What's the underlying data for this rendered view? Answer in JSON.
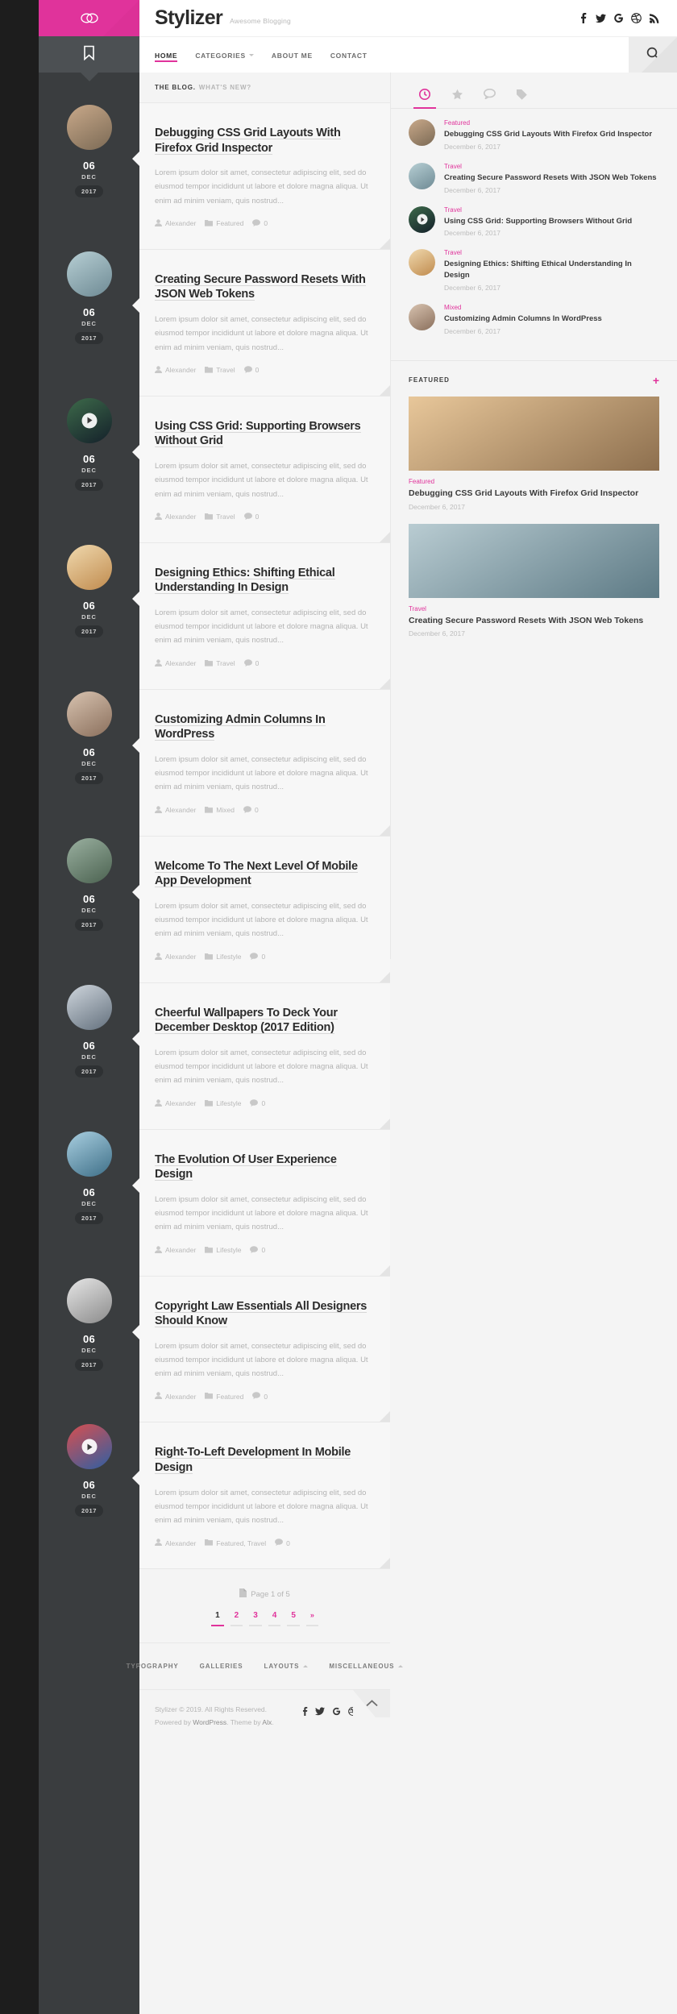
{
  "site": {
    "title": "Stylizer",
    "tagline": "Awesome Blogging",
    "logo_icon": "infinity-logo-icon",
    "bookmark_icon": "bookmark-icon"
  },
  "social": [
    {
      "name": "facebook-icon",
      "label": "f"
    },
    {
      "name": "twitter-icon",
      "label": "t"
    },
    {
      "name": "google-icon",
      "label": "G"
    },
    {
      "name": "dribbble-icon",
      "label": "d"
    },
    {
      "name": "rss-icon",
      "label": "r"
    }
  ],
  "nav": [
    {
      "label": "HOME",
      "active": true,
      "caret": false
    },
    {
      "label": "CATEGORIES",
      "active": false,
      "caret": true
    },
    {
      "label": "ABOUT ME",
      "active": false,
      "caret": false
    },
    {
      "label": "CONTACT",
      "active": false,
      "caret": false
    }
  ],
  "search": {
    "icon": "search-icon",
    "label": "Search"
  },
  "blogbar": {
    "primary": "THE BLOG.",
    "secondary": "WHAT'S NEW?"
  },
  "posts": [
    {
      "title": "Debugging CSS Grid Layouts With Firefox Grid Inspector",
      "excerpt": "Lorem ipsum dolor sit amet, consectetur adipiscing elit, sed do eiusmod tempor incididunt ut labore et dolore magna aliqua. Ut enim ad minim veniam, quis nostrud...",
      "author": "Alexander",
      "category": "Featured",
      "comments": "0",
      "day": "06",
      "month": "DEC",
      "year": "2017",
      "has_video": false,
      "thumb_colors": [
        "#c9a98a",
        "#7b6a55"
      ]
    },
    {
      "title": "Creating Secure Password Resets With JSON Web Tokens",
      "excerpt": "Lorem ipsum dolor sit amet, consectetur adipiscing elit, sed do eiusmod tempor incididunt ut labore et dolore magna aliqua. Ut enim ad minim veniam, quis nostrud...",
      "author": "Alexander",
      "category": "Travel",
      "comments": "0",
      "day": "06",
      "month": "DEC",
      "year": "2017",
      "has_video": false,
      "thumb_colors": [
        "#b7cfd4",
        "#6e8a94"
      ]
    },
    {
      "title": "Using CSS Grid: Supporting Browsers Without Grid",
      "excerpt": "Lorem ipsum dolor sit amet, consectetur adipiscing elit, sed do eiusmod tempor incididunt ut labore et dolore magna aliqua. Ut enim ad minim veniam, quis nostrud...",
      "author": "Alexander",
      "category": "Travel",
      "comments": "0",
      "day": "06",
      "month": "DEC",
      "year": "2017",
      "has_video": true,
      "thumb_colors": [
        "#3d6a4a",
        "#14202a"
      ]
    },
    {
      "title": "Designing Ethics: Shifting Ethical Understanding In Design",
      "excerpt": "Lorem ipsum dolor sit amet, consectetur adipiscing elit, sed do eiusmod tempor incididunt ut labore et dolore magna aliqua. Ut enim ad minim veniam, quis nostrud...",
      "author": "Alexander",
      "category": "Travel",
      "comments": "0",
      "day": "06",
      "month": "DEC",
      "year": "2017",
      "has_video": false,
      "thumb_colors": [
        "#f0d9ae",
        "#c08b4e"
      ]
    },
    {
      "title": "Customizing Admin Columns In WordPress",
      "excerpt": "Lorem ipsum dolor sit amet, consectetur adipiscing elit, sed do eiusmod tempor incididunt ut labore et dolore magna aliqua. Ut enim ad minim veniam, quis nostrud...",
      "author": "Alexander",
      "category": "Mixed",
      "comments": "0",
      "day": "06",
      "month": "DEC",
      "year": "2017",
      "has_video": false,
      "thumb_colors": [
        "#d8c3b0",
        "#8a6f5c"
      ]
    },
    {
      "title": "Welcome To The Next Level Of Mobile App Development",
      "excerpt": "Lorem ipsum dolor sit amet, consectetur adipiscing elit, sed do eiusmod tempor incididunt ut labore et dolore magna aliqua. Ut enim ad minim veniam, quis nostrud...",
      "author": "Alexander",
      "category": "Lifestyle",
      "comments": "0",
      "day": "06",
      "month": "DEC",
      "year": "2017",
      "has_video": false,
      "thumb_colors": [
        "#9ab0a0",
        "#4b6250"
      ]
    },
    {
      "title": "Cheerful Wallpapers To Deck Your December Desktop (2017 Edition)",
      "excerpt": "Lorem ipsum dolor sit amet, consectetur adipiscing elit, sed do eiusmod tempor incididunt ut labore et dolore magna aliqua. Ut enim ad minim veniam, quis nostrud...",
      "author": "Alexander",
      "category": "Lifestyle",
      "comments": "0",
      "day": "06",
      "month": "DEC",
      "year": "2017",
      "has_video": false,
      "thumb_colors": [
        "#cfd6dd",
        "#63707d"
      ]
    },
    {
      "title": "The Evolution Of User Experience Design",
      "excerpt": "Lorem ipsum dolor sit amet, consectetur adipiscing elit, sed do eiusmod tempor incididunt ut labore et dolore magna aliqua. Ut enim ad minim veniam, quis nostrud...",
      "author": "Alexander",
      "category": "Lifestyle",
      "comments": "0",
      "day": "06",
      "month": "DEC",
      "year": "2017",
      "has_video": false,
      "thumb_colors": [
        "#a9cfe0",
        "#3e6f88"
      ]
    },
    {
      "title": "Copyright Law Essentials All Designers Should Know",
      "excerpt": "Lorem ipsum dolor sit amet, consectetur adipiscing elit, sed do eiusmod tempor incididunt ut labore et dolore magna aliqua. Ut enim ad minim veniam, quis nostrud...",
      "author": "Alexander",
      "category": "Featured",
      "comments": "0",
      "day": "06",
      "month": "DEC",
      "year": "2017",
      "has_video": false,
      "thumb_colors": [
        "#e6e6e6",
        "#8b8b8b"
      ]
    },
    {
      "title": "Right-To-Left Development In Mobile Design",
      "excerpt": "Lorem ipsum dolor sit amet, consectetur adipiscing elit, sed do eiusmod tempor incididunt ut labore et dolore magna aliqua. Ut enim ad minim veniam, quis nostrud...",
      "author": "Alexander",
      "category": "Featured, Travel",
      "comments": "0",
      "day": "06",
      "month": "DEC",
      "year": "2017",
      "has_video": true,
      "thumb_colors": [
        "#d94f4f",
        "#2e5fa3"
      ]
    }
  ],
  "sidebar": {
    "tabs": [
      {
        "name": "recent-clock-icon",
        "active": true
      },
      {
        "name": "popular-star-icon",
        "active": false
      },
      {
        "name": "comments-icon",
        "active": false
      },
      {
        "name": "tags-icon",
        "active": false
      }
    ],
    "recent": [
      {
        "category": "Featured",
        "title": "Debugging CSS Grid Layouts With Firefox Grid Inspector",
        "date": "December 6, 2017",
        "has_video": false,
        "thumb_colors": [
          "#c9a98a",
          "#7b6a55"
        ]
      },
      {
        "category": "Travel",
        "title": "Creating Secure Password Resets With JSON Web Tokens",
        "date": "December 6, 2017",
        "has_video": false,
        "thumb_colors": [
          "#b7cfd4",
          "#6e8a94"
        ]
      },
      {
        "category": "Travel",
        "title": "Using CSS Grid: Supporting Browsers Without Grid",
        "date": "December 6, 2017",
        "has_video": true,
        "thumb_colors": [
          "#3d6a4a",
          "#14202a"
        ]
      },
      {
        "category": "Travel",
        "title": "Designing Ethics: Shifting Ethical Understanding In Design",
        "date": "December 6, 2017",
        "has_video": false,
        "thumb_colors": [
          "#f0d9ae",
          "#c08b4e"
        ]
      },
      {
        "category": "Mixed",
        "title": "Customizing Admin Columns In WordPress",
        "date": "December 6, 2017",
        "has_video": false,
        "thumb_colors": [
          "#d8c3b0",
          "#8a6f5c"
        ]
      }
    ],
    "featured_widget": {
      "title": "FEATURED",
      "add_icon": "plus-icon",
      "cards": [
        {
          "category": "Featured",
          "title": "Debugging CSS Grid Layouts With Firefox Grid Inspector",
          "date": "December 6, 2017",
          "thumb_colors": [
            "#e8c79a",
            "#8d6f4e"
          ]
        },
        {
          "category": "Travel",
          "title": "Creating Secure Password Resets With JSON Web Tokens",
          "date": "December 6, 2017",
          "thumb_colors": [
            "#b9ccd2",
            "#5d7a85"
          ]
        }
      ]
    }
  },
  "pagination": {
    "page_label": "Page 1 of 5",
    "page_icon": "document-icon",
    "items": [
      {
        "label": "1",
        "current": true
      },
      {
        "label": "2",
        "current": false
      },
      {
        "label": "3",
        "current": false
      },
      {
        "label": "4",
        "current": false
      },
      {
        "label": "5",
        "current": false
      },
      {
        "label": "»",
        "current": false
      }
    ]
  },
  "footer": {
    "nav": [
      {
        "label": "TYPOGRAPHY",
        "caret": false
      },
      {
        "label": "GALLERIES",
        "caret": false
      },
      {
        "label": "LAYOUTS",
        "caret": true
      },
      {
        "label": "MISCELLANEOUS",
        "caret": true
      }
    ],
    "copyright_line1": "Stylizer © 2019. All Rights Reserved.",
    "copyright_line2_pre": "Powered by ",
    "copyright_wp": "WordPress",
    "copyright_mid": ". Theme by ",
    "copyright_alx": "Alx",
    "copyright_end": ".",
    "to_top_icon": "chevron-up-icon"
  },
  "colors": {
    "accent": "#e0339b",
    "dark": "#1d1d1d",
    "strip": "#3a3d3f",
    "page_bg": "#f4f4f4",
    "card_bg": "#f7f7f7"
  }
}
